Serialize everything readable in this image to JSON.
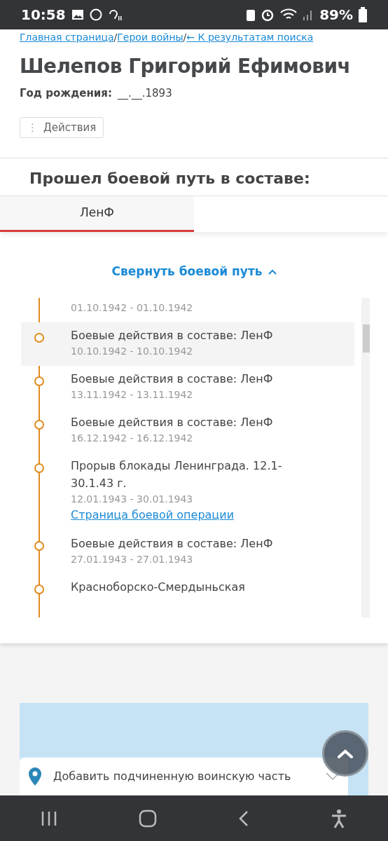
{
  "status_bar": {
    "time": "10:58",
    "battery": "89%"
  },
  "breadcrumbs": [
    {
      "label": "Главная страница"
    },
    {
      "label": "Герои войны"
    },
    {
      "label": "← К результатам поиска"
    }
  ],
  "breadcrumb_separator": "/",
  "person": {
    "name": "Шелепов Григорий Ефимович",
    "birth_label": "Год рождения:",
    "birth_value": "__.__.1893"
  },
  "actions_button": {
    "icon": "⋮",
    "label": "Действия"
  },
  "section_title": "Прошел боевой путь в составе:",
  "tabs": [
    {
      "label": "ЛенФ",
      "selected": true
    }
  ],
  "collapse_link": "Свернуть боевой путь",
  "timeline": [
    {
      "dates": "01.10.1942 - 01.10.1942",
      "selected": false
    },
    {
      "title": "Боевые действия в составе: ЛенФ",
      "dates": "10.10.1942 - 10.10.1942",
      "selected": true
    },
    {
      "title": "Боевые действия в составе: ЛенФ",
      "dates": "13.11.1942 - 13.11.1942",
      "selected": false
    },
    {
      "title": "Боевые действия в составе: ЛенФ",
      "dates": "16.12.1942 - 16.12.1942",
      "selected": false
    },
    {
      "title": "Прорыв блокады Ленинграда. 12.1-30.1.43 г.",
      "dates": "12.01.1943 - 30.01.1943",
      "link": "Страница боевой операции",
      "selected": false
    },
    {
      "title": "Боевые действия в составе: ЛенФ",
      "dates": "27.01.1943 - 27.01.1943",
      "selected": false
    },
    {
      "title": "Красноборско-Смердыньская",
      "selected": false
    }
  ],
  "map_panel": {
    "dropdown": "Добавить подчиненную воинскую часть"
  }
}
